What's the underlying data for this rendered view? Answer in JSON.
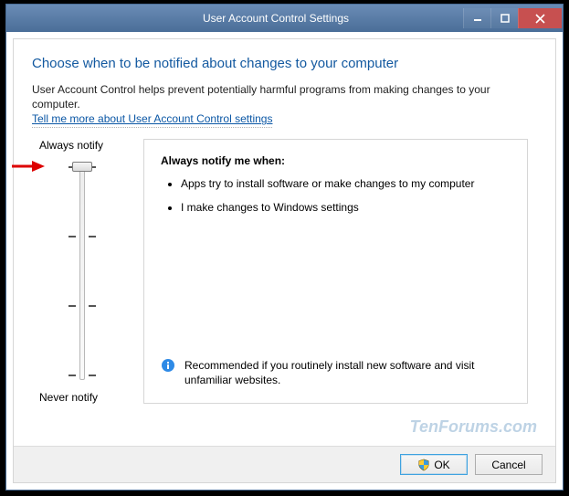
{
  "window": {
    "title": "User Account Control Settings"
  },
  "heading": "Choose when to be notified about changes to your computer",
  "description": "User Account Control helps prevent potentially harmful programs from making changes to your computer.",
  "help_link": "Tell me more about User Account Control settings",
  "slider": {
    "top_label": "Always notify",
    "bottom_label": "Never notify"
  },
  "panel": {
    "title": "Always notify me when:",
    "bullets": [
      "Apps try to install software or make changes to my computer",
      "I make changes to Windows settings"
    ],
    "recommendation": "Recommended if you routinely install new software and visit unfamiliar websites."
  },
  "buttons": {
    "ok": "OK",
    "cancel": "Cancel"
  },
  "watermark": "TenForums.com"
}
